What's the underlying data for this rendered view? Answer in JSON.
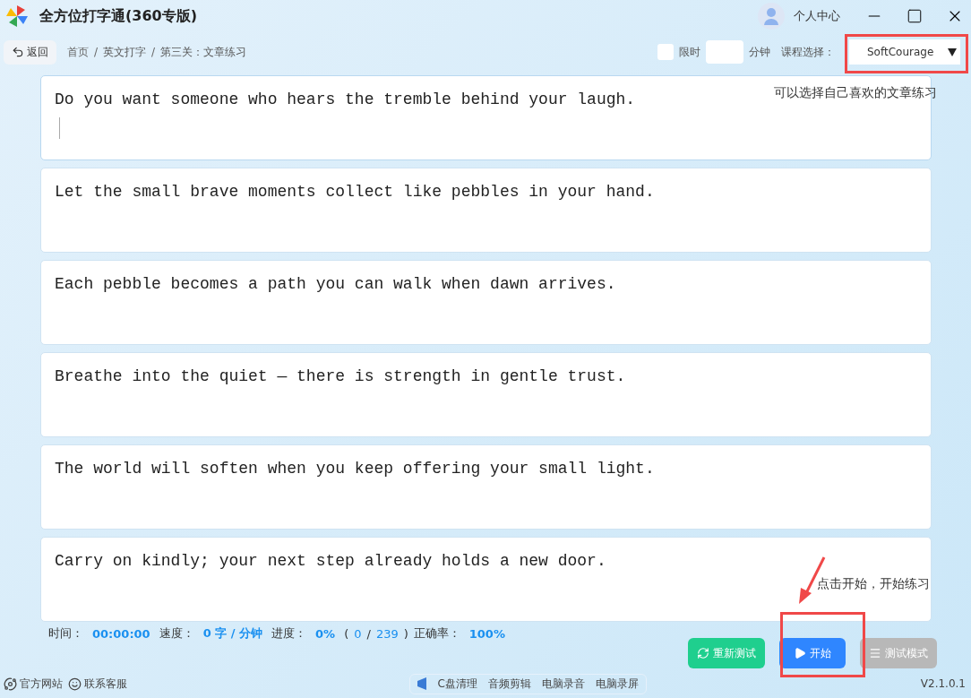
{
  "window": {
    "title": "全方位打字通(360专版)",
    "user": "个人中心"
  },
  "toolbar": {
    "back": "返回",
    "breadcrumb": [
      "首页",
      "英文打字",
      "第三关：文章练习"
    ],
    "breadcrumb_separator": "/",
    "time_limit": {
      "label": "限时",
      "checked": false,
      "unit": "分钟"
    },
    "course_label": "课程选择：",
    "course": "SoftCourage"
  },
  "passages": [
    {
      "text": "Do you want someone who hears the tremble behind your laugh.",
      "selected": true
    },
    {
      "text": "Let the small brave moments collect like pebbles in your hand.",
      "selected": false
    },
    {
      "text": "Each pebble becomes a path you can walk when dawn arrives.",
      "selected": false
    },
    {
      "text": "Breathe into the quiet — there is strength in gentle trust.",
      "selected": false
    },
    {
      "text": "The world will soften when you keep offering your small light.",
      "selected": false
    },
    {
      "text": "Carry on kindly; your next step already holds a new door.",
      "selected": false
    }
  ],
  "stats": [
    {
      "label": "时间：",
      "value": "00:00:00"
    },
    {
      "label": "速度：",
      "value": "0 字 / 分钟"
    },
    {
      "label": "进度：",
      "value": "0%",
      "open": "(",
      "done": "0",
      "sep": "/",
      "total": "239",
      "close": ")"
    },
    {
      "label": "正确率：",
      "value": "100%"
    }
  ],
  "buttons": [
    {
      "kind": "restart",
      "label": "重新测试",
      "disabled": false
    },
    {
      "kind": "start",
      "label": "开始",
      "disabled": false
    },
    {
      "kind": "test",
      "label": "测试模式",
      "disabled": true
    }
  ],
  "annotations": [
    {
      "kind": "dropdown",
      "note": "可以选择自己喜欢的文章练习"
    },
    {
      "kind": "start",
      "note": "点击开始，开始练习"
    }
  ],
  "footer": {
    "links": [
      "官方网站",
      "联系客服"
    ],
    "tools": [
      "C盘清理",
      "音频剪辑",
      "电脑录音",
      "电脑录屏"
    ],
    "version": "V2.1.0.1"
  }
}
